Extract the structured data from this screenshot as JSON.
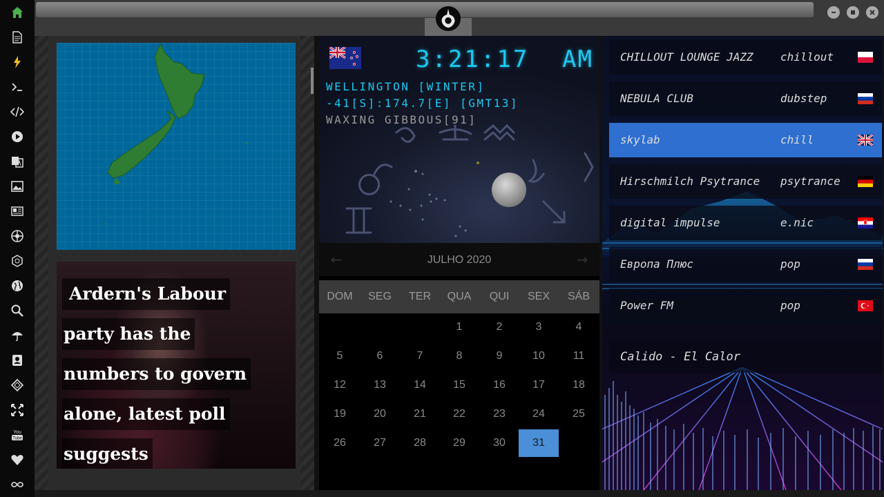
{
  "sidebar": {
    "icons": [
      "home-icon",
      "document-icon",
      "lightning-icon",
      "terminal-icon",
      "code-icon",
      "play-icon",
      "translate-icon",
      "image-icon",
      "news-icon",
      "rebel-icon",
      "empire-icon",
      "globe-icon",
      "search-icon",
      "umbrella-icon",
      "contact-icon",
      "tag-icon",
      "expand-icon",
      "youtube-icon",
      "heart-icon",
      "infinity-icon"
    ],
    "youtube_top": "You",
    "youtube_bottom": "Tube"
  },
  "news": {
    "lines": [
      "Ardern's Labour",
      "party has the",
      "numbers to govern",
      "alone, latest poll",
      "suggests"
    ]
  },
  "clock": {
    "time": "3:21:17",
    "ampm": "AM",
    "location": "WELLINGTON [WINTER]",
    "coords": "-41[S]:174.7[E] [GMT13]",
    "moon": "WAXING GIBBOUS[91]"
  },
  "calendar": {
    "month": "JULHO 2020",
    "weekdays": [
      "DOM",
      "SEG",
      "TER",
      "QUA",
      "QUI",
      "SEX",
      "SÁB"
    ],
    "today": "31"
  },
  "radio": {
    "stations": [
      {
        "name": "CHILLOUT LOUNGE JAZZ",
        "genre": "chillout",
        "flag": "poland"
      },
      {
        "name": "NEBULA CLUB",
        "genre": "dubstep",
        "flag": "russia"
      },
      {
        "name": "skylab",
        "genre": "chill",
        "flag": "uk"
      },
      {
        "name": "Hirschmilch Psytrance",
        "genre": "psytrance",
        "flag": "germany"
      },
      {
        "name": "digital impulse",
        "genre": "e.nic",
        "flag": "croatia"
      },
      {
        "name": "Европа Плюс",
        "genre": "pop",
        "flag": "russia"
      },
      {
        "name": "Power FM",
        "genre": "pop",
        "flag": "turkey"
      }
    ],
    "now_playing": "Calido - El Calor"
  },
  "colors": {
    "accent_cyan": "#1ec8f0",
    "active_station": "#2e6fd0",
    "calendar_today": "#4a8fd8",
    "map_sea": "#00679a",
    "map_land": "#2e7d32"
  }
}
